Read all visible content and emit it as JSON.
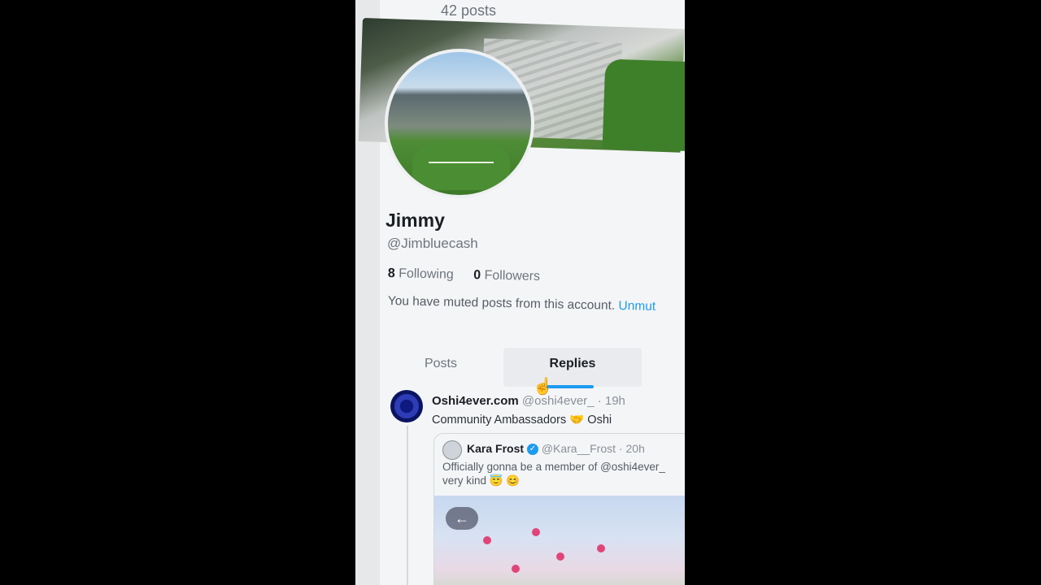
{
  "header": {
    "post_count": "42 posts"
  },
  "profile": {
    "name": "Jimmy",
    "handle": "@Jimbluecash",
    "following_count": "8",
    "following_label": "Following",
    "followers_count": "0",
    "followers_label": "Followers",
    "muted_notice": "You have muted posts from this account.",
    "unmute_label": "Unmut"
  },
  "tabs": [
    {
      "label": "Posts",
      "active": false
    },
    {
      "label": "Replies",
      "active": true
    }
  ],
  "reply": {
    "author_name": "Oshi4ever.com",
    "author_handle": "@oshi4ever_",
    "time": "· 19h",
    "text": "Community Ambassadors 🤝 Oshi"
  },
  "quote": {
    "author_name": "Kara Frost",
    "author_handle": "@Kara__Frost",
    "time": "· 20h",
    "text_line1": "Officially gonna be a member of @oshi4ever_",
    "text_line2": "very kind 😇 😊",
    "back_label": "←"
  },
  "colors": {
    "accent": "#1d9bf0",
    "text": "#1b1f23",
    "muted": "#6e767d"
  },
  "icons": {
    "cursor": "hand-pointer-icon",
    "verified": "verified-badge-icon",
    "back": "arrow-left-icon"
  }
}
